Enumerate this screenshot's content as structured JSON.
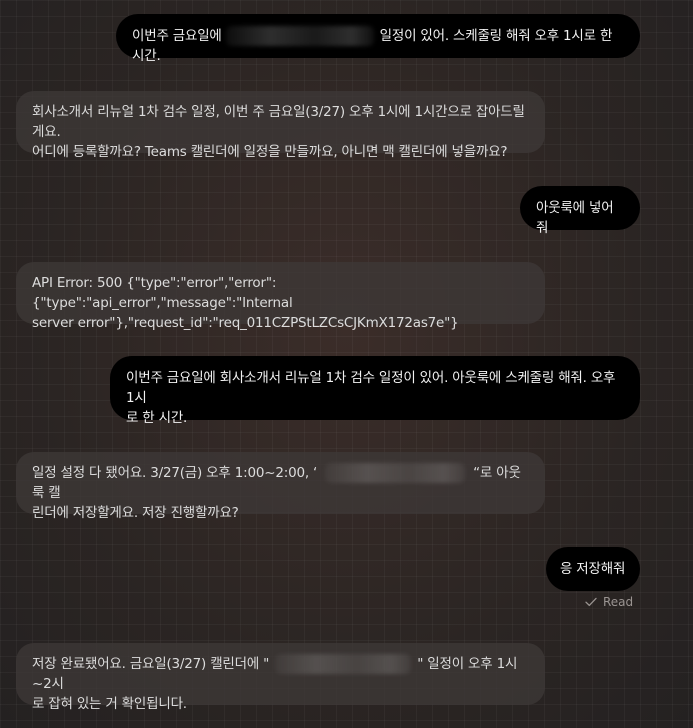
{
  "messages": [
    {
      "role": "user",
      "before": "이번주 금요일에",
      "after": "일정이 있어. 스케줄링 해줘 오후 1시로 한 시간."
    },
    {
      "role": "assistant",
      "line1": "회사소개서 리뉴얼 1차 검수 일정, 이번 주 금요일(3/27) 오후 1시에 1시간으로 잡아드릴게요.",
      "line2": "어디에 등록할까요? Teams 캘린더에 일정을 만들까요, 아니면 맥 캘린더에 넣을까요?"
    },
    {
      "role": "user",
      "text": "아웃룩에 넣어줘"
    },
    {
      "role": "assistant",
      "line1": "API Error: 500 {\"type\":\"error\",\"error\":{\"type\":\"api_error\",\"message\":\"Internal",
      "line2": "server error\"},\"request_id\":\"req_011CZPStLZCsCJKmX172as7e\"}"
    },
    {
      "role": "user",
      "line1": "이번주 금요일에 회사소개서 리뉴얼 1차 검수 일정이 있어. 아웃룩에 스케줄링 해줘. 오후 1시",
      "line2": "로 한 시간."
    },
    {
      "role": "assistant",
      "line1_before": "일정 설정 다 됐어요. 3/27(금) 오후 1:00~2:00, ‘",
      "line1_after": "“로 아웃룩 캘",
      "line2": "린더에 저장할게요. 저장 진행할까요?"
    },
    {
      "role": "user",
      "text": "응 저장해줘"
    },
    {
      "role": "assistant",
      "line1_before": "저장 완료됐어요. 금요일(3/27) 캘린더에 \"",
      "line1_after": "\" 일정이 오후 1시~2시",
      "line2": "로 잡혀 있는 거 확인됩니다."
    }
  ],
  "read_receipt": {
    "label": "Read",
    "icon": "checkmark-icon"
  },
  "colors": {
    "user_bubble": "#000000",
    "assistant_bubble": "#3e3837",
    "background": "#2c2624",
    "text": "#dcdcdc",
    "read_text": "#9a9491"
  }
}
